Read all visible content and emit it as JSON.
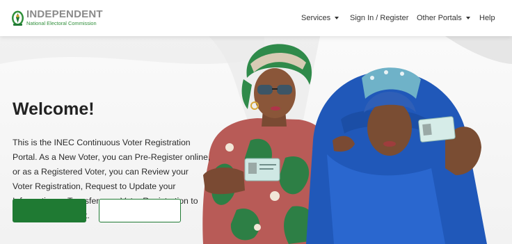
{
  "brand": {
    "title": "INDEPENDENT",
    "subtitle": "National Electoral Commission",
    "logo_icon": "inec-crest-icon",
    "title_color": "#8a8a8a",
    "subtitle_color": "#2f8f3a"
  },
  "nav": {
    "services": "Services",
    "signin": "Sign In / Register",
    "other_portals": "Other Portals",
    "help": "Help",
    "dropdown_icon": "caret-down-icon"
  },
  "hero": {
    "title": "Welcome!",
    "body": "This is the INEC Continuous Voter Registration Portal. As a New Voter, you can Pre-Register online, or as a Registered Voter, you can Review your Voter Registration, Request to Update your Information or Transfer your Voter Registration to another Polling Unit.",
    "primary_color": "#1f7a33"
  }
}
